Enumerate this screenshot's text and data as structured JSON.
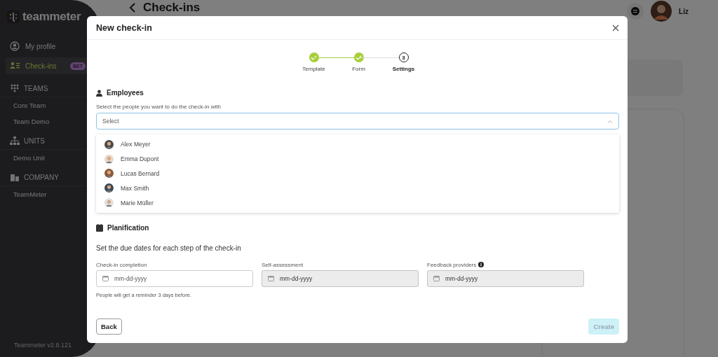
{
  "sidebar": {
    "logo": "teammeter",
    "nav": [
      {
        "label": "My profile",
        "selected": false
      },
      {
        "label": "Check-ins",
        "selected": true,
        "badge": "BET"
      }
    ],
    "sections": [
      {
        "title": "TEAMS",
        "items": [
          "Core Team",
          "Team Demo"
        ]
      },
      {
        "title": "UNITS",
        "items": [
          "Demo Unit"
        ]
      },
      {
        "title": "COMPANY",
        "items": [
          "TeamMeter"
        ]
      }
    ],
    "version": "Teammeter v2.8.121"
  },
  "header": {
    "title": "Check-ins",
    "user": "Liz"
  },
  "modal": {
    "title": "New check-in",
    "steps": [
      {
        "label": "Template",
        "completed": true
      },
      {
        "label": "Form",
        "completed": true
      },
      {
        "label": "Settings",
        "completed": false,
        "number": "3"
      }
    ],
    "employees": {
      "title": "Employees",
      "label": "Select the people you want to do the check-in with",
      "placeholder": "Select",
      "expanded": true,
      "options": [
        "Alex Meyer",
        "Emma Dupont",
        "Lucas Bernard",
        "Max Smith",
        "Marie Müller"
      ]
    },
    "planification": {
      "title": "Planification",
      "intro": "Set the due dates for each step of the check-in",
      "dates": [
        {
          "label": "Check-in completion",
          "placeholder": "mm-dd-yyyy",
          "disabled": false,
          "info": false
        },
        {
          "label": "Self-assessment",
          "placeholder": "mm-dd-yyyy",
          "disabled": true,
          "info": false
        },
        {
          "label": "Feedback providers",
          "placeholder": "mm-dd-yyyy",
          "disabled": true,
          "info": true
        }
      ],
      "hint": "People will get a reminder 3 days before."
    },
    "back": {
      "label": "Back"
    },
    "create": {
      "label": "Create",
      "disabled": true
    }
  }
}
